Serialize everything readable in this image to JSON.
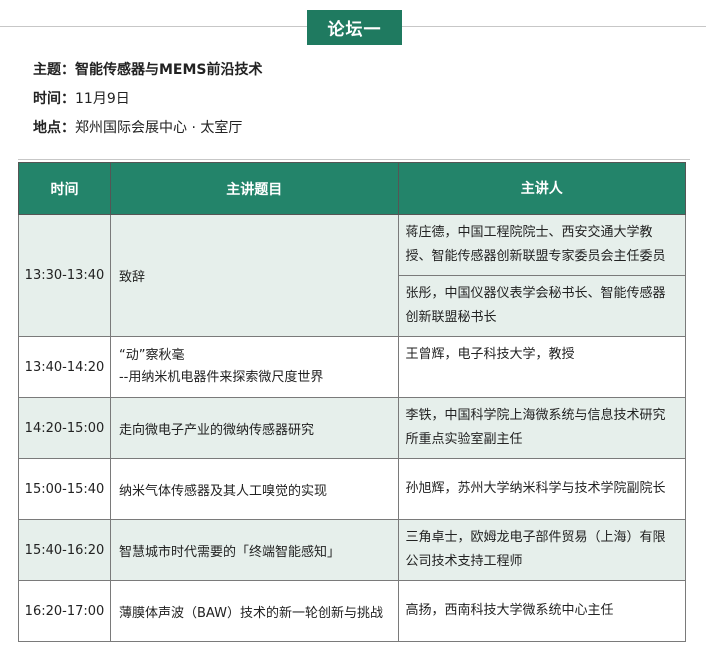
{
  "header": {
    "badge": "论坛一"
  },
  "info": {
    "topic_label": "主题：",
    "topic_value": "智能传感器与MEMS前沿技术",
    "time_label": "时间：",
    "time_value": "11月9日",
    "place_label": "地点：",
    "place_value": "郑州国际会展中心 · 太室厅"
  },
  "table": {
    "headers": [
      "时间",
      "主讲题目",
      "主讲人"
    ],
    "rows": [
      {
        "time": "13:30-13:40",
        "topic": "致辞",
        "speakers": [
          "蒋庄德，中国工程院院士、西安交通大学教授、智能传感器创新联盟专家委员会主任委员",
          "张彤，中国仪器仪表学会秘书长、智能传感器创新联盟秘书长"
        ]
      },
      {
        "time": "13:40-14:20",
        "topic_line1": "“动”察秋毫",
        "topic_line2": "--用纳米机电器件来探索微尺度世界",
        "speaker": "王曾辉，电子科技大学，教授"
      },
      {
        "time": "14:20-15:00",
        "topic": "走向微电子产业的微纳传感器研究",
        "speaker": "李铁，中国科学院上海微系统与信息技术研究所重点实验室副主任"
      },
      {
        "time": "15:00-15:40",
        "topic": "纳米气体传感器及其人工嗅觉的实现",
        "speaker": "孙旭辉，苏州大学纳米科学与技术学院副院长"
      },
      {
        "time": "15:40-16:20",
        "topic": "智慧城市时代需要的「终端智能感知」",
        "speaker": "三角卓士，欧姆龙电子部件贸易（上海）有限公司技术支持工程师"
      },
      {
        "time": "16:20-17:00",
        "topic": "薄膜体声波（BAW）技术的新一轮创新与挑战",
        "speaker": "高扬，西南科技大学微系统中心主任"
      }
    ]
  }
}
